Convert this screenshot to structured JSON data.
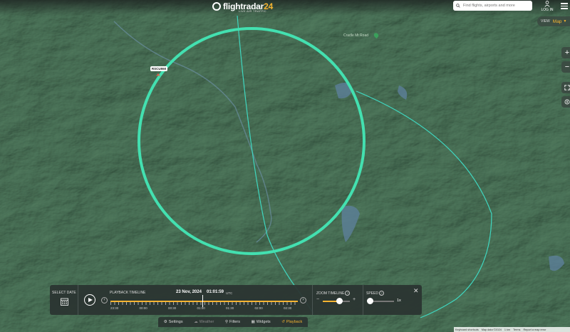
{
  "header": {
    "logo_text": "flightradar",
    "logo_number": "24",
    "logo_subtitle": "LIVE AIR TRAFFIC",
    "search_placeholder": "Find flights, airports and more",
    "login_label": "LOG IN"
  },
  "view_control": {
    "view_label": "VIEW",
    "map_label": "Map"
  },
  "map": {
    "aircraft_label": "RSCU550",
    "poi_label": "Cradle Mt Road",
    "track_color": "#3fd7c0",
    "circle_color": "#43e0b0"
  },
  "side_buttons": {
    "zoom_in": "+",
    "zoom_out": "−"
  },
  "playback": {
    "select_date_label": "SELECT DATE",
    "timeline_label": "PLAYBACK TIMELINE",
    "date": "23 Nov, 2024",
    "time": "01:01:59",
    "timezone": "UTC",
    "tick_labels": [
      "23:30",
      "00:00",
      "00:30",
      "01:00",
      "01:30",
      "02:00",
      "02:30"
    ],
    "zoom_timeline_label": "ZOOM TIMELINE",
    "zoom_minus": "−",
    "zoom_plus": "+",
    "speed_label": "SPEED",
    "speed_value": "1x",
    "zoom_level": 0.63,
    "timeline_progress": 0.49,
    "close": "✕"
  },
  "bottom_bar": {
    "settings": "Settings",
    "weather": "Weather",
    "filters": "Filters",
    "widgets": "Widgets",
    "playback": "Playback"
  },
  "attribution": {
    "shortcuts": "Keyboard shortcuts",
    "map_data": "Map data ©2024",
    "scale": "1 km",
    "terms": "Terms",
    "report": "Report a map error"
  }
}
